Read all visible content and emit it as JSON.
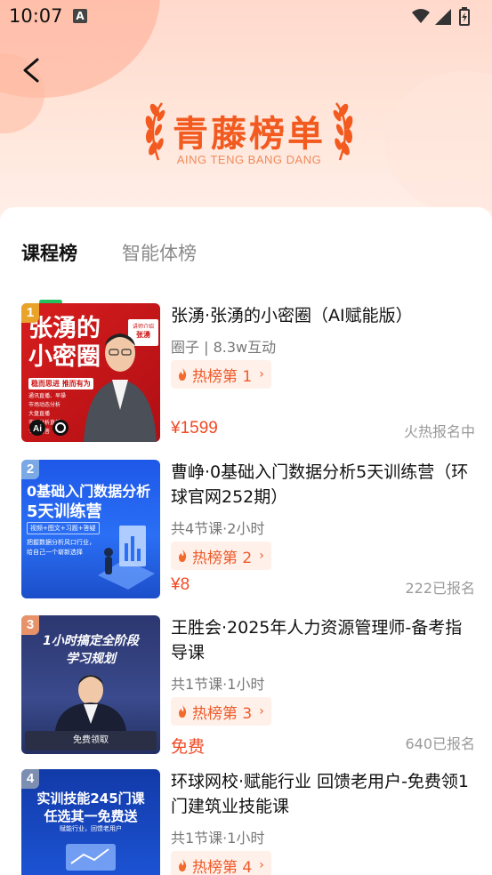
{
  "status": {
    "time": "10:07",
    "notif_icon": "A"
  },
  "header": {
    "back_icon": "chevron-left-icon",
    "title": "青藤榜单",
    "subtitle": "AING TENG BANG DANG"
  },
  "tabs": [
    {
      "label": "课程榜",
      "active": true
    },
    {
      "label": "智能体榜",
      "active": false
    }
  ],
  "colors": {
    "accent_green": "#22c35e",
    "price_red": "#f04a26",
    "hot_orange": "#ee5a2a",
    "title_orange": "#f25a1f"
  },
  "items": [
    {
      "rank": "1",
      "title": "张湧·张湧的小密圈（AI赋能版）",
      "meta": "圈子 | 8.3w互动",
      "hot": "热榜第 1",
      "price": "¥1599",
      "signup": "火热报名中",
      "thumb": {
        "line1": "张湧的",
        "line2": "小密圈",
        "tag": "稳而思进  推而有为",
        "intro_label": "讲师介绍",
        "intro_name": "张湧",
        "bullets": [
          "通讯直播、早操",
          "市场动态分析",
          "大盘直播",
          "市场分析直播",
          "专业问答"
        ]
      }
    },
    {
      "rank": "2",
      "title": "曹峥·0基础入门数据分析5天训练营（环球官网252期）",
      "meta": "共4节课·2小时",
      "hot": "热榜第 2",
      "price": "¥8",
      "signup": "222已报名",
      "thumb": {
        "line1": "0基础入门数据分析",
        "line2": "5天训练营",
        "tag": "视频+图文+习题+答疑",
        "desc1": "把握数据分析风口行业，",
        "desc2": "给自己一个崭新选择"
      }
    },
    {
      "rank": "3",
      "title": "王胜会·2025年人力资源管理师-备考指导课",
      "meta": "共1节课·1小时",
      "hot": "热榜第 3",
      "price": "免费",
      "signup": "640已报名",
      "thumb": {
        "line1": "1小时搞定全阶段",
        "line2": "学习规划",
        "bottom": "免费领取"
      }
    },
    {
      "rank": "4",
      "title": "环球网校·赋能行业 回馈老用户-免费领1门建筑业技能课",
      "meta": "共1节课·1小时",
      "hot": "热榜第 4",
      "price": "",
      "signup": "",
      "thumb": {
        "line1": "实训技能245门课",
        "line2": "任选其一免费送",
        "tag": "赋能行业，回馈老用户"
      }
    }
  ]
}
